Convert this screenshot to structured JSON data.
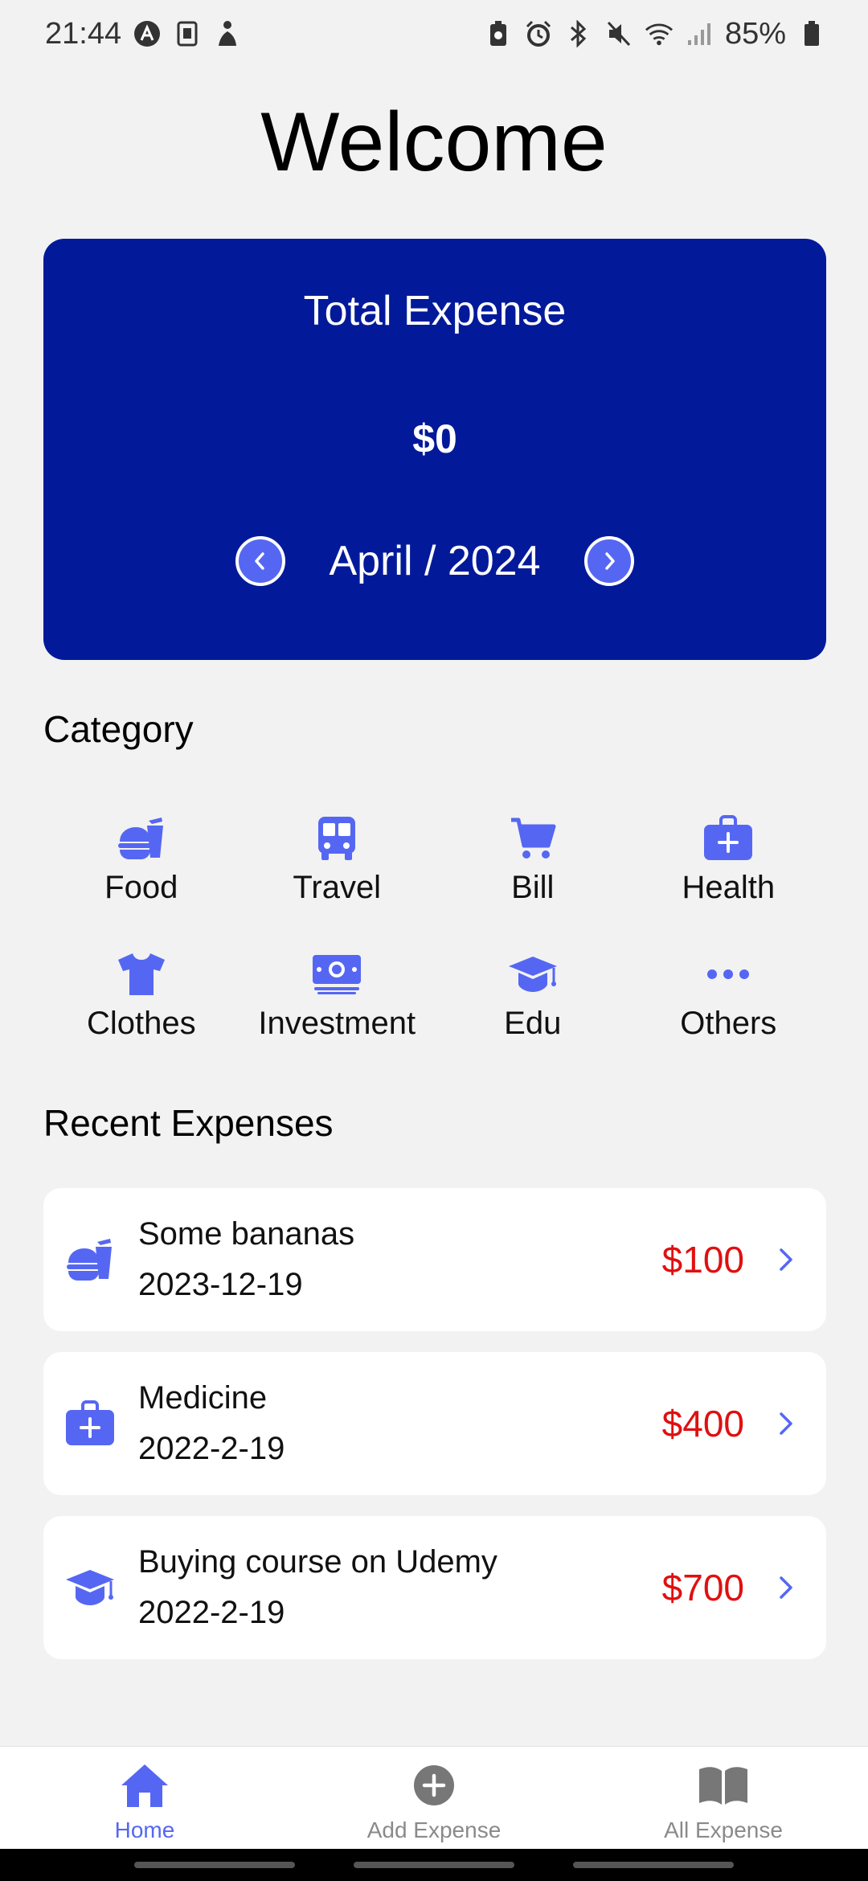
{
  "status_bar": {
    "time": "21:44",
    "battery": "85%",
    "left_icons": [
      "autopilot-icon",
      "sim-card-icon",
      "accessibility-icon"
    ],
    "right_icons": [
      "battery-saver-icon",
      "alarm-icon",
      "bluetooth-icon",
      "mute-icon",
      "wifi-icon",
      "signal-icon",
      "battery-icon"
    ]
  },
  "header": {
    "title": "Welcome"
  },
  "total_card": {
    "title": "Total Expense",
    "amount": "$0",
    "month": "April / 2024",
    "background": "#021a9a"
  },
  "category_section": {
    "title": "Category",
    "items": [
      {
        "label": "Food",
        "icon": "food-icon"
      },
      {
        "label": "Travel",
        "icon": "bus-icon"
      },
      {
        "label": "Bill",
        "icon": "cart-icon"
      },
      {
        "label": "Health",
        "icon": "medical-kit-icon"
      },
      {
        "label": "Clothes",
        "icon": "shirt-icon"
      },
      {
        "label": "Investment",
        "icon": "money-icon"
      },
      {
        "label": "Edu",
        "icon": "graduation-cap-icon"
      },
      {
        "label": "Others",
        "icon": "more-dots-icon"
      }
    ]
  },
  "recent_section": {
    "title": "Recent Expenses",
    "items": [
      {
        "name": "Some bananas",
        "date": "2023-12-19",
        "amount": "$100",
        "icon": "food-icon"
      },
      {
        "name": "Medicine",
        "date": "2022-2-19",
        "amount": "$400",
        "icon": "medical-kit-icon"
      },
      {
        "name": "Buying course on Udemy",
        "date": "2022-2-19",
        "amount": "$700",
        "icon": "graduation-cap-icon"
      }
    ]
  },
  "bottom_nav": {
    "items": [
      {
        "label": "Home",
        "icon": "home-icon",
        "active": true
      },
      {
        "label": "Add Expense",
        "icon": "add-circle-icon",
        "active": false
      },
      {
        "label": "All Expense",
        "icon": "book-icon",
        "active": false
      }
    ]
  },
  "colors": {
    "accent": "#5567f2",
    "amount": "#e01010",
    "card_bg": "#021a9a",
    "page_bg": "#f2f2f2"
  }
}
